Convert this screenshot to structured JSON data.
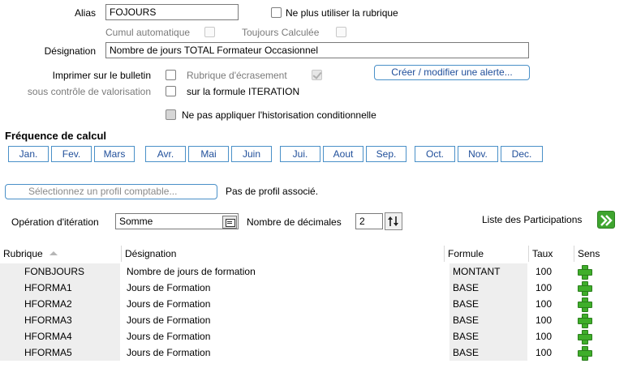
{
  "form": {
    "alias_label": "Alias",
    "alias_value": "FOJOURS",
    "ne_plus_label": "Ne plus utiliser la rubrique",
    "cumul_label": "Cumul automatique",
    "toujours_label": "Toujours Calculée",
    "designation_label": "Désignation",
    "designation_value": "Nombre de jours TOTAL Formateur Occasionnel",
    "imprimer_label": "Imprimer sur le bulletin",
    "sous_controle_label": "sous contrôle de valorisation",
    "ecrasement_label": "Rubrique d'écrasement",
    "iteration_formula_label": "sur la formule ITERATION",
    "alerte_button": "Créer / modifier une alerte...",
    "historisation_label": "Ne pas appliquer l'historisation conditionnelle"
  },
  "frequence": {
    "title": "Fréquence de calcul",
    "months": [
      "Jan.",
      "Fev.",
      "Mars",
      "Avr.",
      "Mai",
      "Juin",
      "Jui.",
      "Aout",
      "Sep.",
      "Oct.",
      "Nov.",
      "Dec."
    ]
  },
  "profil": {
    "button": "Sélectionnez un profil comptable...",
    "status": "Pas de profil associé."
  },
  "iteration": {
    "operation_label": "Opération d'itération",
    "operation_value": "Somme",
    "decimales_label": "Nombre de décimales",
    "decimales_value": "2",
    "participations_label": "Liste des Participations"
  },
  "table": {
    "headers": [
      "Rubrique",
      "Désignation",
      "Formule",
      "Taux",
      "Sens"
    ],
    "rows": [
      {
        "rubrique": "FONBJOURS",
        "designation": "Nombre de jours de formation",
        "formule": "MONTANT",
        "taux": "100"
      },
      {
        "rubrique": "HFORMA1",
        "designation": "Jours de Formation",
        "formule": "BASE",
        "taux": "100"
      },
      {
        "rubrique": "HFORMA2",
        "designation": "Jours de Formation",
        "formule": "BASE",
        "taux": "100"
      },
      {
        "rubrique": "HFORMA3",
        "designation": "Jours de Formation",
        "formule": "BASE",
        "taux": "100"
      },
      {
        "rubrique": "HFORMA4",
        "designation": "Jours de Formation",
        "formule": "BASE",
        "taux": "100"
      },
      {
        "rubrique": "HFORMA5",
        "designation": "Jours de Formation",
        "formule": "BASE",
        "taux": "100"
      }
    ]
  },
  "icons": {
    "combo": "list-picker-icon",
    "spinner": "updown-spinner-icon",
    "go": "double-chevron-right-icon",
    "sens": "plus-icon"
  }
}
